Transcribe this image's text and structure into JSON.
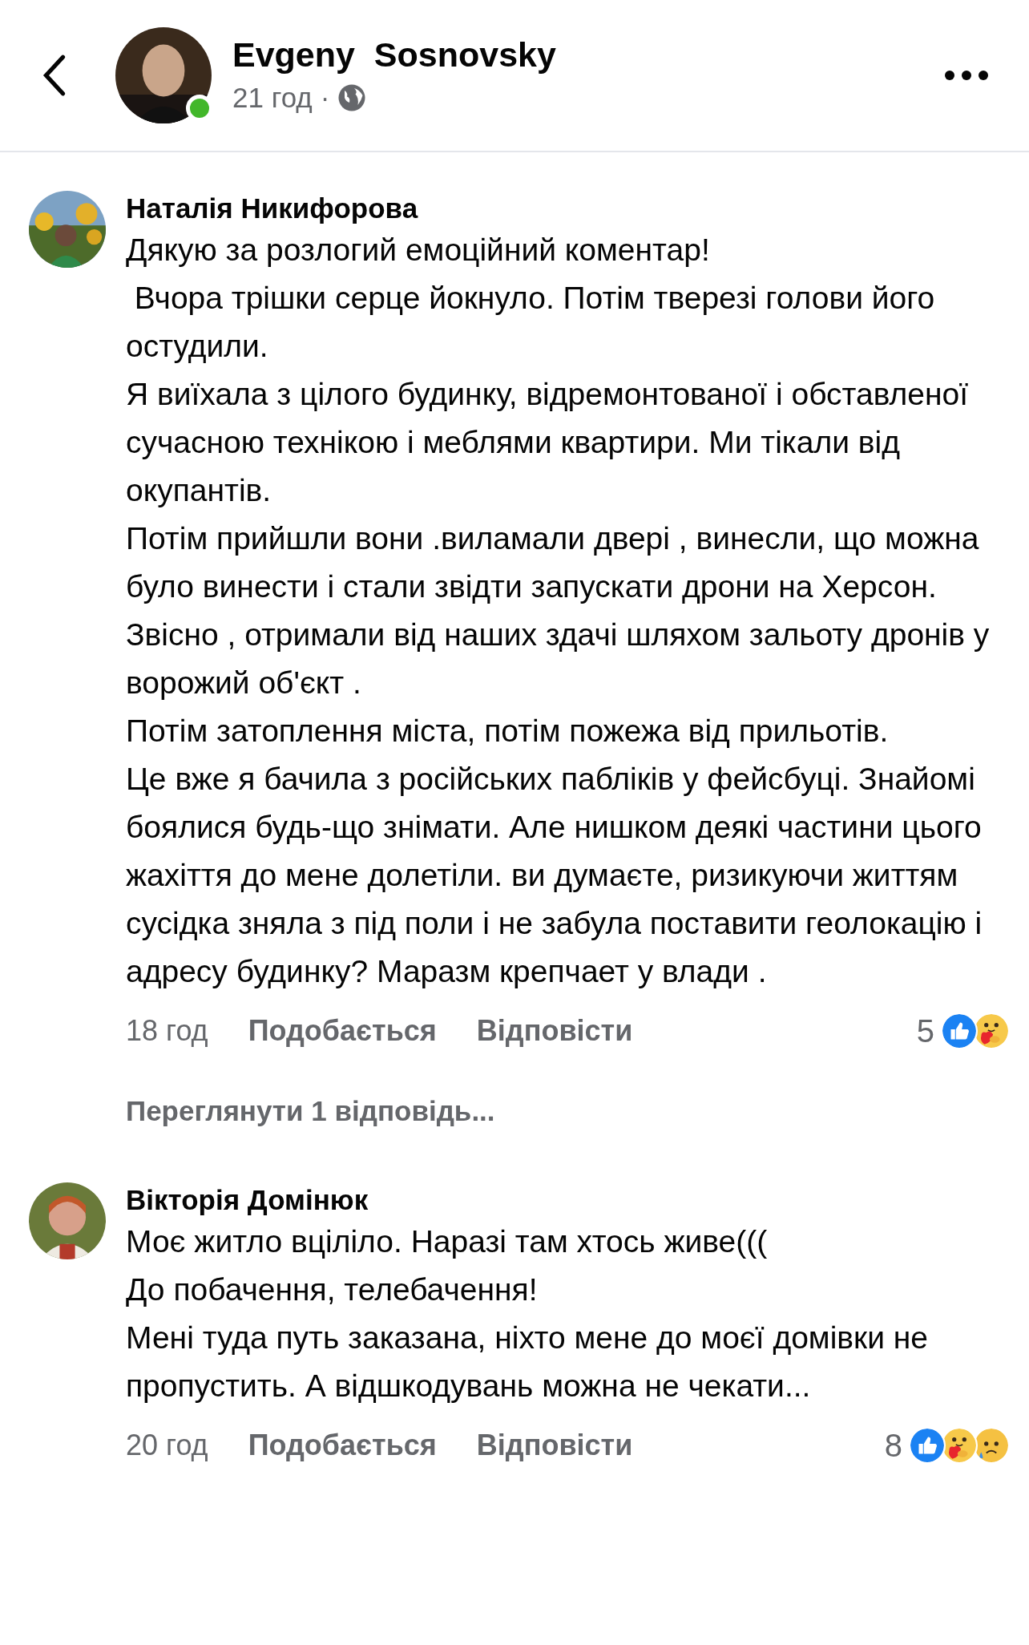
{
  "header": {
    "author": "Evgeny  Sosnovsky",
    "online": true,
    "time": "21 год",
    "separator": "·"
  },
  "comments": [
    {
      "author": "Наталія Никифорова",
      "paragraphs": [
        "Дякую за розлогий емоційний коментар!",
        " Вчора трішки серце йокнуло. Потім тверезі голови його остудили.",
        "Я виїхала з цілого будинку, відремонтованої і обставленої сучасною технікою і меблями квартири. Ми тікали від окупантів.",
        "Потім прийшли вони .виламали двері , винесли, що можна було винести і стали звідти запускати дрони на Херсон. Звісно , отримали від наших здачі шляхом зальоту дронів у ворожий об'єкт .",
        "Потім затоплення міста, потім пожежа від прильотів.",
        "Це вже я бачила з російських пабліків у фейсбуці. Знайомі боялися будь-що знімати. Але нишком деякі частини цього жахіття до мене долетіли. ви думаєте, ризикуючи життям сусідка зняла з під поли і не забула поставити геолокацію і адресу будинку? Маразм крепчает у влади ."
      ],
      "time": "18 год",
      "like": "Подобається",
      "reply": "Відповісти",
      "count": "5",
      "reactions": [
        {
          "kind": "like"
        },
        {
          "kind": "care"
        }
      ],
      "replies_link": "Переглянути 1 відповідь..."
    },
    {
      "author": "Вікторія Домінюк",
      "paragraphs": [
        "Моє житло вціліло. Наразі там хтось живе(((",
        "До побачення, телебачення!",
        "Мені туда путь заказана, ніхто мене до моєї домівки не пропустить. А відшкодувань можна не чекати..."
      ],
      "time": "20 год",
      "like": "Подобається",
      "reply": "Відповісти",
      "count": "8",
      "reactions": [
        {
          "kind": "like"
        },
        {
          "kind": "care"
        },
        {
          "kind": "sad"
        }
      ]
    }
  ]
}
